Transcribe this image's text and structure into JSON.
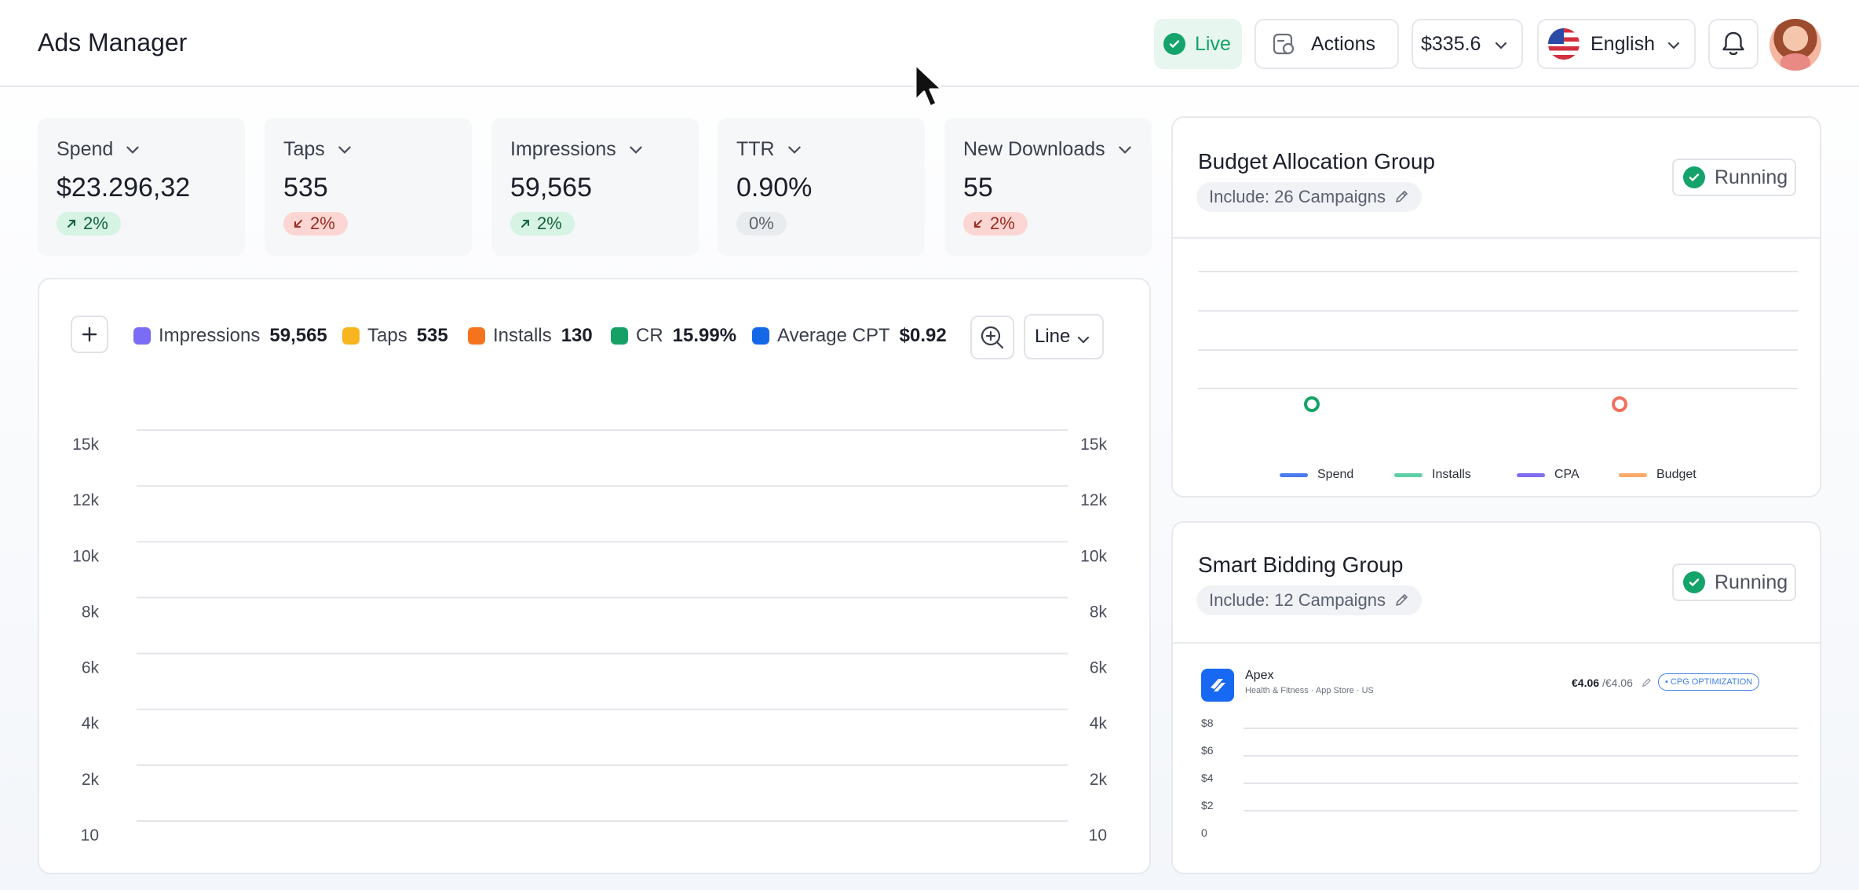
{
  "header": {
    "title": "Ads Manager",
    "live_label": "Live",
    "actions_label": "Actions",
    "balance": "$335.6",
    "language": "English"
  },
  "metrics": [
    {
      "label": "Spend",
      "value": "$23.296,32",
      "change": "2%",
      "trend": "up"
    },
    {
      "label": "Taps",
      "value": "535",
      "change": "2%",
      "trend": "down"
    },
    {
      "label": "Impressions",
      "value": "59,565",
      "change": "2%",
      "trend": "up"
    },
    {
      "label": "TTR",
      "value": "0.90%",
      "change": "0%",
      "trend": "flat"
    },
    {
      "label": "New Downloads",
      "value": "55",
      "change": "2%",
      "trend": "down"
    }
  ],
  "main_chart": {
    "legend": [
      {
        "label": "Impressions",
        "value": "59,565",
        "color": "#7b6cf5"
      },
      {
        "label": "Taps",
        "value": "535",
        "color": "#f8b520"
      },
      {
        "label": "Installs",
        "value": "130",
        "color": "#f6731e"
      },
      {
        "label": "CR",
        "value": "15.99%",
        "color": "#16a066"
      },
      {
        "label": "Average CPT",
        "value": "$0.92",
        "color": "#1468e8"
      }
    ],
    "chart_type": "Line"
  },
  "chart_data": {
    "type": "line",
    "title": "",
    "y_ticks_left": [
      "15k",
      "12k",
      "10k",
      "8k",
      "6k",
      "4k",
      "2k",
      "10"
    ],
    "y_ticks_right": [
      "15k",
      "12k",
      "10k",
      "8k",
      "6k",
      "4k",
      "2k",
      "10"
    ],
    "series": [],
    "grid": true
  },
  "budget_card": {
    "title": "Budget Allocation Group",
    "include": "Include: 26 Campaigns",
    "status": "Running",
    "legend": [
      {
        "label": "Spend",
        "color": "#4a7cf0"
      },
      {
        "label": "Installs",
        "color": "#5fd0a6"
      },
      {
        "label": "CPA",
        "color": "#7e6cf3"
      },
      {
        "label": "Budget",
        "color": "#f9a96a"
      }
    ]
  },
  "smart_card": {
    "title": "Smart Bidding Group",
    "include": "Include: 12 Campaigns",
    "status": "Running",
    "app": {
      "name": "Apex",
      "meta": "Health & Fitness · App Store · US",
      "bid": "€4.06",
      "bid_max": "/€4.06",
      "badge": "• CPG OPTIMIZATION"
    },
    "y_ticks": [
      "$8",
      "$6",
      "$4",
      "$2",
      "0"
    ]
  }
}
